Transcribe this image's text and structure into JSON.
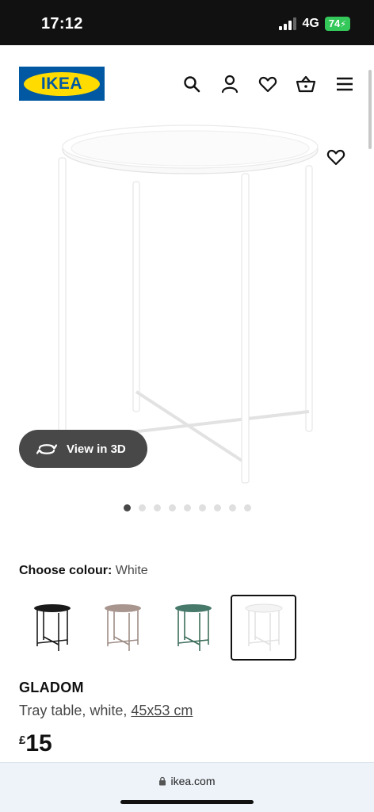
{
  "status_bar": {
    "time": "17:12",
    "network": "4G",
    "battery": "74"
  },
  "header": {
    "logo_text": "IKEA",
    "icons": [
      "search-icon",
      "account-icon",
      "heart-icon",
      "basket-icon",
      "menu-icon"
    ]
  },
  "product": {
    "view_3d_label": "View in 3D",
    "gallery_dots": 9,
    "gallery_active_index": 0,
    "choose_colour_label": "Choose colour:",
    "selected_colour": "White",
    "colour_swatches": [
      {
        "colour": "#1a1a1a",
        "selected": false
      },
      {
        "colour": "#9e8d86",
        "selected": false
      },
      {
        "colour": "#3e6f5c",
        "selected": false
      },
      {
        "colour": "#eeeeee",
        "selected": true
      }
    ],
    "name": "GLADOM",
    "description": "Tray table, white, ",
    "size": "45x53 cm",
    "currency": "£",
    "price": "15"
  },
  "browser": {
    "url": "ikea.com"
  },
  "colors": {
    "brand_blue": "#0058a3",
    "brand_yellow": "#ffdb00",
    "dark": "#111111"
  }
}
